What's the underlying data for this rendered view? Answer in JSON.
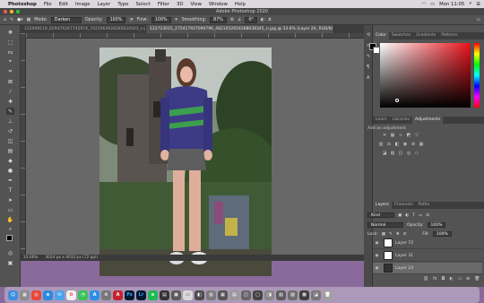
{
  "menubar": {
    "app": "Photoshop",
    "items": [
      "File",
      "Edit",
      "Image",
      "Layer",
      "Type",
      "Select",
      "Filter",
      "3D",
      "View",
      "Window",
      "Help"
    ],
    "clock": "Mon 11:05"
  },
  "window": {
    "title": "Adobe Photoshop 2020"
  },
  "options": {
    "mode_label": "Mode:",
    "mode_value": "Darken",
    "opacity_label": "Opacity:",
    "opacity_value": "100%",
    "flow_label": "Flow:",
    "flow_value": "100%",
    "smoothing_label": "Smoothing:",
    "smoothing_value": "87%",
    "angle": "0°"
  },
  "tabs": [
    {
      "label": "122908119_629476247745974_7421064928285634503_n.jpg"
    },
    {
      "label": "122723015_275417937090796_4821052654288038345_n.jpg @ 33.6% (Layer 24, RGB/8) *"
    }
  ],
  "status": {
    "zoom": "33.66%",
    "doc": "3024 px x 4032 px (72 ppi)"
  },
  "color_panel": {
    "tabs": [
      "Color",
      "Swatches",
      "Gradients",
      "Patterns"
    ],
    "fg": "#000000",
    "bg": "#ffffff",
    "hue_color": "#e8121a"
  },
  "adjust_panel": {
    "tabs": [
      "Learn",
      "Libraries",
      "Adjustments"
    ],
    "title": "Add an adjustment"
  },
  "layers_panel": {
    "tabs": [
      "Layers",
      "Channels",
      "Paths"
    ],
    "filter": "Kind",
    "blend": "Normal",
    "opacity_label": "Opacity:",
    "opacity": "100%",
    "lock_label": "Lock:",
    "fill_label": "Fill:",
    "fill": "100%",
    "layers": [
      {
        "name": "Layer 72"
      },
      {
        "name": "Layer 31"
      },
      {
        "name": "Layer 24"
      }
    ]
  },
  "dock": {
    "apps": [
      "Finder",
      "Launchpad",
      "Chrome",
      "Safari",
      "Mail",
      "Photos",
      "Messages",
      "App Store",
      "Settings",
      "Adobe",
      "Ps",
      "Lr",
      "Spotify"
    ]
  }
}
